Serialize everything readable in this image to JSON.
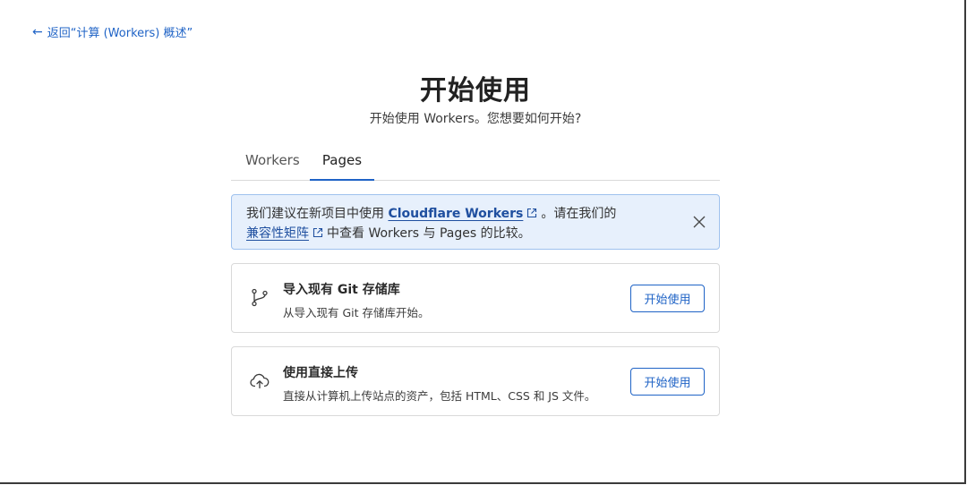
{
  "nav": {
    "back_arrow": "←",
    "back_label": "返回“计算 (Workers) 概述”"
  },
  "header": {
    "title": "开始使用",
    "subtitle": "开始使用 Workers。您想要如何开始?"
  },
  "tabs": [
    {
      "label": "Workers",
      "active": false
    },
    {
      "label": "Pages",
      "active": true
    }
  ],
  "banner": {
    "text_1": "我们建议在新项目中使用 ",
    "link_1": "Cloudflare Workers",
    "text_2": "。请在我们的",
    "link_2": "兼容性矩阵",
    "text_3": "中查看 Workers 与 Pages 的比较。",
    "icons": [
      "external-link-icon",
      "close-icon"
    ]
  },
  "cards": [
    {
      "icon": "git-branch-icon",
      "title": "导入现有 Git 存储库",
      "description": "从导入现有 Git 存储库开始。",
      "button": "开始使用"
    },
    {
      "icon": "cloud-upload-icon",
      "title": "使用直接上传",
      "description": "直接从计算机上传站点的资产，包括 HTML、CSS 和 JS 文件。",
      "button": "开始使用"
    }
  ],
  "colors": {
    "accent": "#1f63c6",
    "banner_bg": "#e7f0fc",
    "banner_border": "#9ec1ee",
    "card_border": "#d9d9d9"
  }
}
